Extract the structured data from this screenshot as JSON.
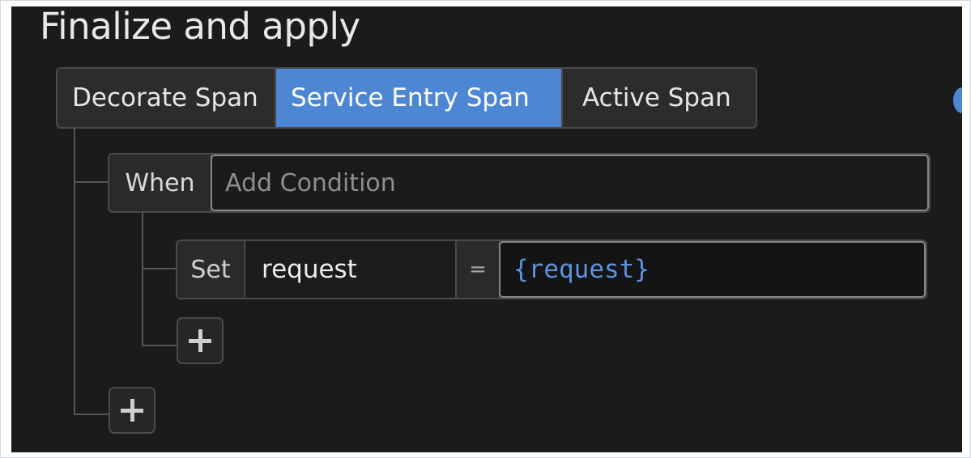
{
  "page": {
    "title": "Finalize and apply"
  },
  "tabs": [
    {
      "label": "Decorate Span",
      "active": false
    },
    {
      "label": "Service Entry Span",
      "active": true
    },
    {
      "label": "Active Span",
      "active": false
    }
  ],
  "condition": {
    "keyword": "When",
    "placeholder": "Add Condition",
    "value": ""
  },
  "action": {
    "keyword": "Set",
    "key": "request",
    "operator": "=",
    "value": "{request}"
  },
  "buttons": {
    "add_action_icon": "plus-icon",
    "add_rule_icon": "plus-icon"
  },
  "colors": {
    "background": "#1b1b1b",
    "accent": "#4d86d3",
    "value_text": "#5b93e0"
  }
}
